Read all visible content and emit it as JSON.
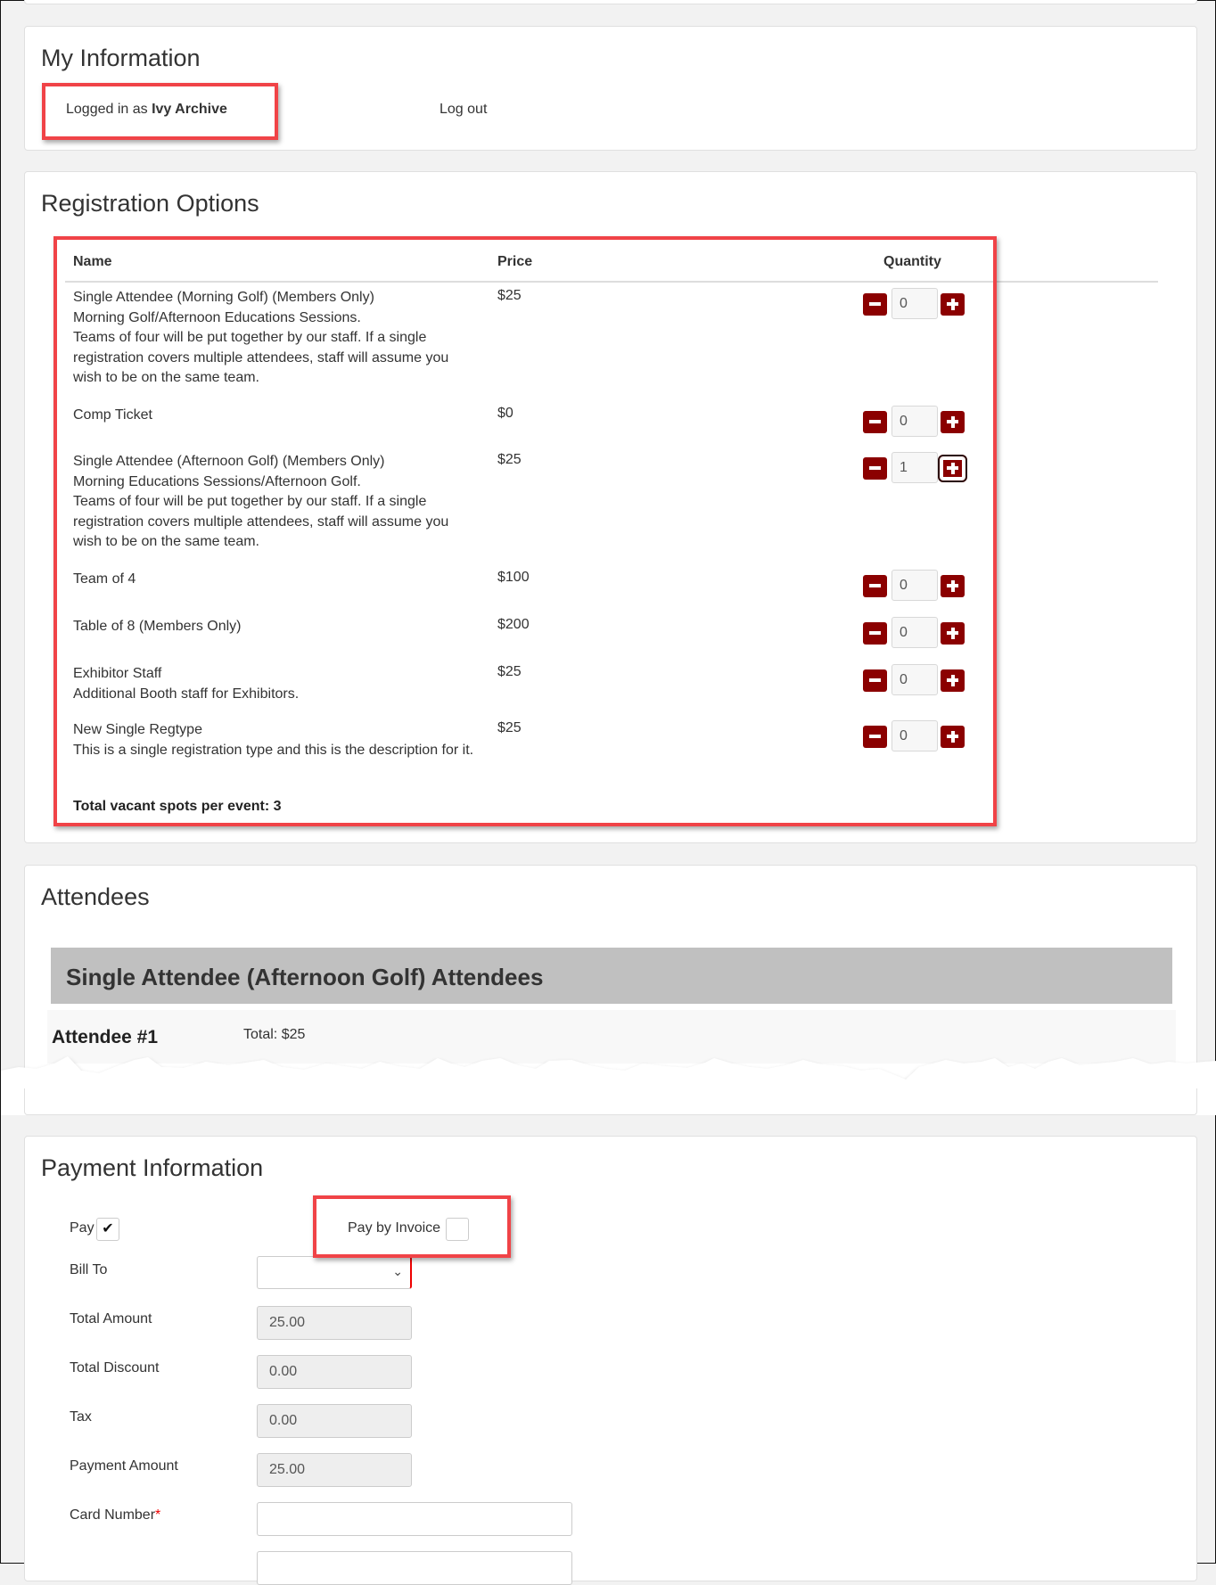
{
  "my_information": {
    "title": "My Information",
    "logged_in_prefix": "Logged in as ",
    "user_name": "Ivy Archive",
    "logout_label": "Log out"
  },
  "registration_options": {
    "title": "Registration Options",
    "columns": {
      "name": "Name",
      "price": "Price",
      "quantity": "Quantity"
    },
    "rows": [
      {
        "name": "Single Attendee (Morning Golf) (Members Only)",
        "description": "Morning Golf/Afternoon Educations Sessions.\nTeams of four will be put together by our staff. If a single registration covers multiple attendees, staff will assume you wish to be on the same team.",
        "price": "$25",
        "quantity": "0"
      },
      {
        "name": "Comp Ticket",
        "description": "",
        "price": "$0",
        "quantity": "0"
      },
      {
        "name": "Single Attendee (Afternoon Golf) (Members Only)",
        "description": "Morning Educations Sessions/Afternoon Golf.\nTeams of four will be put together by our staff. If a single registration covers multiple attendees, staff will assume you wish to be on the same team.",
        "price": "$25",
        "quantity": "1"
      },
      {
        "name": "Team of 4",
        "description": "",
        "price": "$100",
        "quantity": "0"
      },
      {
        "name": "Table of 8 (Members Only)",
        "description": "",
        "price": "$200",
        "quantity": "0"
      },
      {
        "name": "Exhibitor Staff",
        "description": "Additional Booth staff for Exhibitors.",
        "price": "$25",
        "quantity": "0"
      },
      {
        "name": "New Single Regtype",
        "description": "This is a single registration type and this is the description for it.",
        "price": "$25",
        "quantity": "0"
      }
    ],
    "total_vacant": "Total vacant spots per event: 3"
  },
  "attendees": {
    "title": "Attendees",
    "group_heading": "Single Attendee (Afternoon Golf) Attendees",
    "attendee_label": "Attendee #1",
    "attendee_total": "Total: $25"
  },
  "payment": {
    "title": "Payment Information",
    "pay_label": "Pay",
    "pay_checked": true,
    "pay_by_invoice_label": "Pay by Invoice",
    "pay_by_invoice_checked": false,
    "bill_to_label": "Bill To",
    "bill_to_value": "",
    "total_amount_label": "Total Amount",
    "total_amount": "25.00",
    "total_discount_label": "Total Discount",
    "total_discount": "0.00",
    "tax_label": "Tax",
    "tax": "0.00",
    "payment_amount_label": "Payment Amount",
    "payment_amount": "25.00",
    "card_number_label": "Card Number",
    "required_mark": "*",
    "card_number_value": ""
  },
  "colors": {
    "accent": "#8b0000",
    "highlight_box": "#f04347",
    "group_header_bg": "#c0c0c0"
  }
}
